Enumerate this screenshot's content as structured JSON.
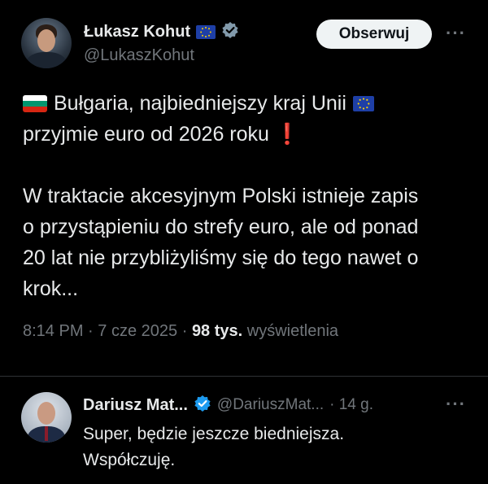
{
  "tweet": {
    "author_name": "Łukasz Kohut",
    "author_handle": "@LukaszKohut",
    "follow_label": "Obserwuj",
    "more_label": "···",
    "line1": "Bułgaria, najbiedniejszy kraj Unii",
    "line2": "przyjmie euro od 2026 roku",
    "exclamation": "❗",
    "paragraph2_lines": [
      "W traktacie akcesyjnym Polski istnieje zapis",
      "o przystąpieniu do strefy euro, ale od ponad",
      "20 lat nie przybliżyliśmy się do tego nawet o",
      "krok..."
    ],
    "time": "8:14 PM",
    "sep": "·",
    "date": "7 cze 2025",
    "views_count": "98 tys.",
    "views_label": "wyświetlenia"
  },
  "reply": {
    "author_name": "Dariusz Mat...",
    "author_handle": "@DariuszMat...",
    "age": "· 14 g.",
    "more_label": "···",
    "lines": [
      "Super, będzie jeszcze biedniejsza.",
      "Współczuję."
    ]
  },
  "colors": {
    "background": "#000000",
    "text": "#e7e9ea",
    "muted": "#71767b",
    "verified": "#829aab",
    "divider": "#2f3336"
  }
}
